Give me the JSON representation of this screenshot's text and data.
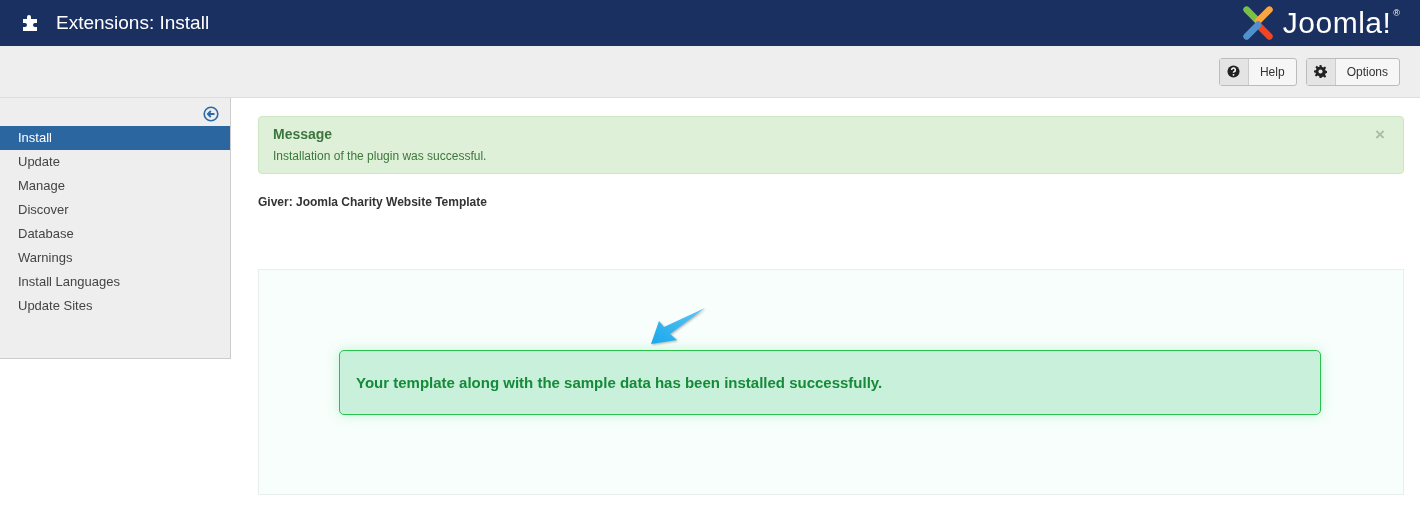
{
  "header": {
    "title": "Extensions: Install",
    "logo_text": "Joomla!",
    "logo_mark": "®"
  },
  "toolbar": {
    "buttons": [
      {
        "kind": "help",
        "label": "Help"
      },
      {
        "kind": "options",
        "label": "Options"
      }
    ]
  },
  "sidebar": {
    "items": [
      {
        "label": "Install",
        "selected": true
      },
      {
        "label": "Update",
        "selected": false
      },
      {
        "label": "Manage",
        "selected": false
      },
      {
        "label": "Discover",
        "selected": false
      },
      {
        "label": "Database",
        "selected": false
      },
      {
        "label": "Warnings",
        "selected": false
      },
      {
        "label": "Install Languages",
        "selected": false
      },
      {
        "label": "Update Sites",
        "selected": false
      }
    ]
  },
  "alert": {
    "heading": "Message",
    "text": "Installation of the plugin was successful.",
    "close": "×"
  },
  "giver": "Giver: Joomla Charity Website Template",
  "result": {
    "text": "Your template along with the sample data has been installed successfully."
  }
}
